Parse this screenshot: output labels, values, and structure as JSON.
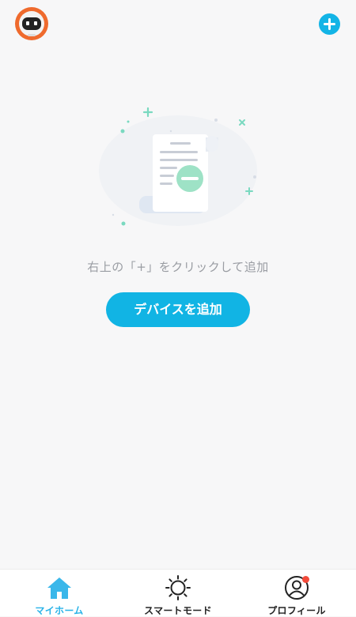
{
  "header": {
    "avatar_icon": "robot-avatar-icon",
    "add_icon": "plus-icon",
    "accent_color": "#13b4e6"
  },
  "empty_state": {
    "illustration_icon": "document-remove-illustration",
    "hint": "右上の「+」をクリックして追加",
    "add_device_label": "デバイスを追加"
  },
  "tabbar": {
    "active_color": "#29b3e8",
    "tabs": [
      {
        "label": "マイホーム",
        "icon": "home-icon",
        "active": true
      },
      {
        "label": "スマートモード",
        "icon": "sun-icon",
        "active": false
      },
      {
        "label": "プロフィール",
        "icon": "user-icon",
        "active": false,
        "badge": true
      }
    ]
  }
}
